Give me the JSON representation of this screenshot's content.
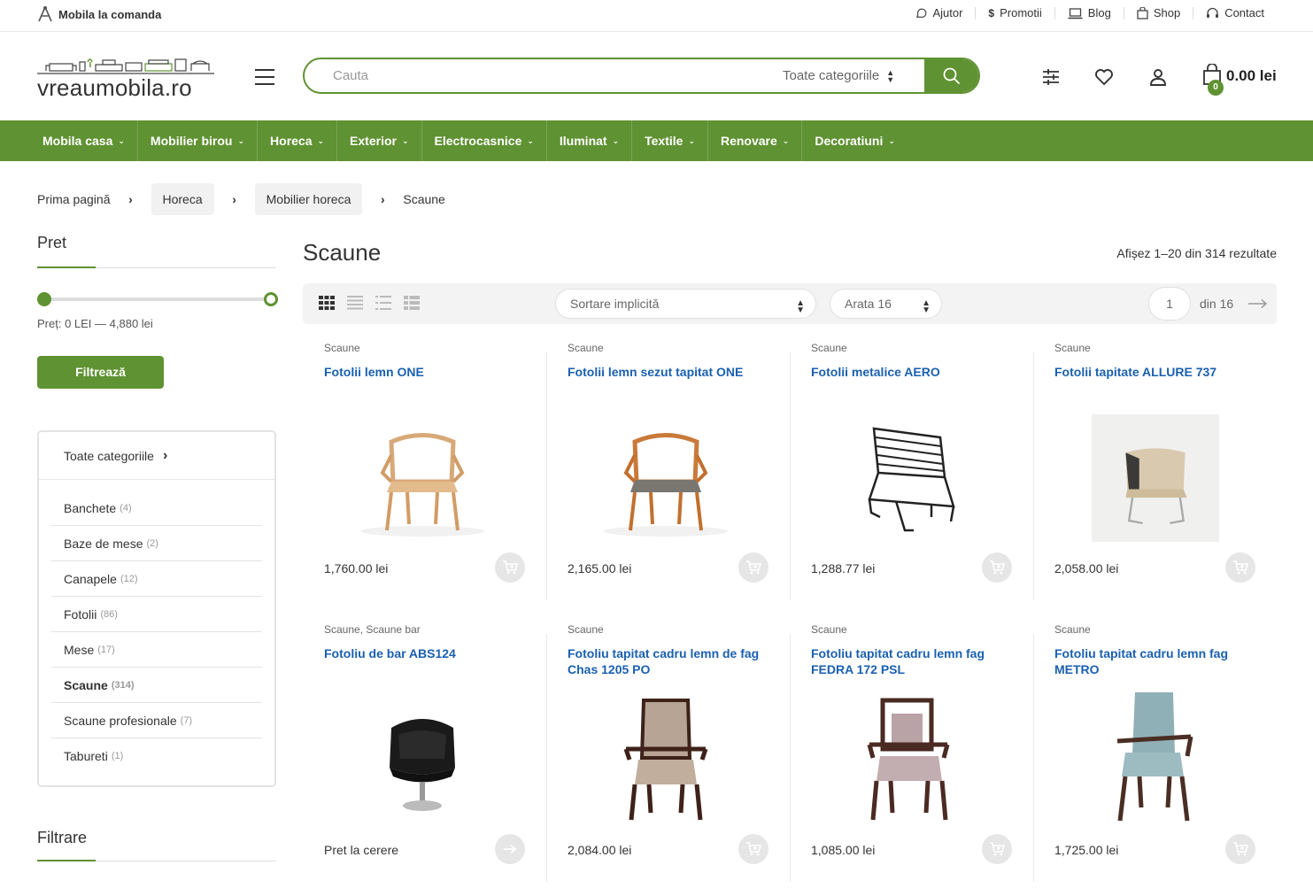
{
  "topbar": {
    "brand": "Mobila la comanda",
    "links": [
      {
        "icon": "chat-icon",
        "label": "Ajutor"
      },
      {
        "icon": "dollar-icon",
        "label": "Promotii"
      },
      {
        "icon": "laptop-icon",
        "label": "Blog"
      },
      {
        "icon": "bag-icon",
        "label": "Shop"
      },
      {
        "icon": "headset-icon",
        "label": "Contact"
      }
    ]
  },
  "header": {
    "logo_text": "vreaumobila.ro",
    "search_placeholder": "Cauta",
    "search_category": "Toate categoriile",
    "cart_count": "0",
    "cart_total": "0.00 lei"
  },
  "menu": [
    "Mobila casa",
    "Mobilier birou",
    "Horeca",
    "Exterior",
    "Electrocasnice",
    "Iluminat",
    "Textile",
    "Renovare",
    "Decoratiuni"
  ],
  "breadcrumbs": [
    "Prima pagină",
    "Horeca",
    "Mobilier horeca",
    "Scaune"
  ],
  "sidebar": {
    "price_title": "Pret",
    "price_range_text": "Preț: 0 LEI — 4,880 lei",
    "price_min_fraction": 0,
    "price_max_fraction": 1,
    "filter_button": "Filtrează",
    "categories_header": "Toate categoriile",
    "categories": [
      {
        "name": "Banchete",
        "count": "(4)"
      },
      {
        "name": "Baze de mese",
        "count": "(2)"
      },
      {
        "name": "Canapele",
        "count": "(12)"
      },
      {
        "name": "Fotolii",
        "count": "(86)"
      },
      {
        "name": "Mese",
        "count": "(17)"
      },
      {
        "name": "Scaune",
        "count": "(314)",
        "active": true
      },
      {
        "name": "Scaune profesionale",
        "count": "(7)"
      },
      {
        "name": "Tabureti",
        "count": "(1)"
      }
    ],
    "filter_title": "Filtrare"
  },
  "main": {
    "title": "Scaune",
    "results": "Afișez 1–20 din 314 rezultate",
    "sort": "Sortare implicită",
    "per_page": "Arata 16",
    "page_current": "1",
    "page_total": "din 16"
  },
  "products": [
    {
      "category": "Scaune",
      "name": "Fotolii lemn ONE",
      "price": "1,760.00 lei",
      "img": "wood-armchair"
    },
    {
      "category": "Scaune",
      "name": "Fotolii lemn sezut tapitat ONE",
      "price": "2,165.00 lei",
      "img": "wood-armchair-upholstered"
    },
    {
      "category": "Scaune",
      "name": "Fotolii metalice AERO",
      "price": "1,288.77 lei",
      "img": "metal-chair"
    },
    {
      "category": "Scaune",
      "name": "Fotolii tapitate ALLURE 737",
      "price": "2,058.00 lei",
      "img": "tub-chair"
    },
    {
      "category": "Scaune, Scaune bar",
      "name": "Fotoliu de bar ABS124",
      "price": "Pret la cerere",
      "img": "leather-swivel"
    },
    {
      "category": "Scaune",
      "name": "Fotoliu tapitat cadru lemn de fag Chas 1205 PO",
      "price": "2,084.00 lei",
      "img": "beech-armchair-beige"
    },
    {
      "category": "Scaune",
      "name": "Fotoliu tapitat cadru lemn fag FEDRA 172 PSL",
      "price": "1,085.00 lei",
      "img": "beech-armchair-pink"
    },
    {
      "category": "Scaune",
      "name": "Fotoliu tapitat cadru lemn fag METRO",
      "price": "1,725.00 lei",
      "img": "beech-armchair-blue"
    }
  ],
  "colors": {
    "accent": "#5f9232",
    "link": "#1a60b0"
  }
}
